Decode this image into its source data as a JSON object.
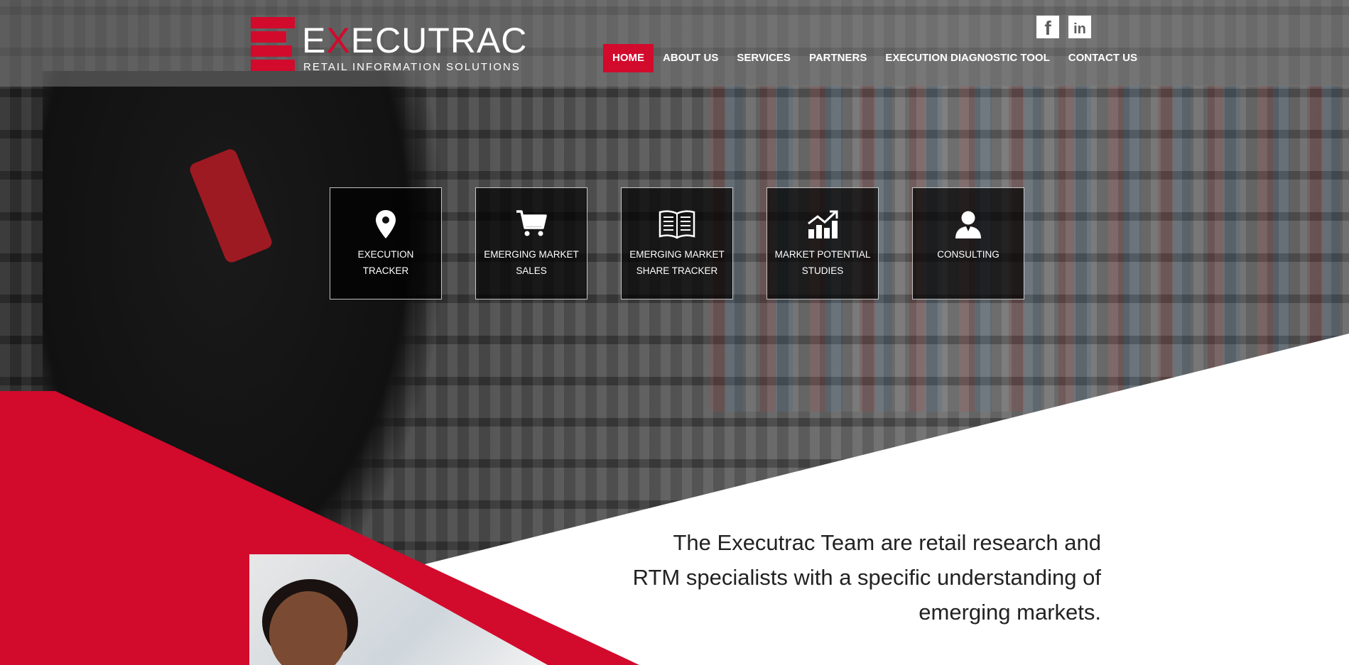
{
  "brand": {
    "name_prefix": "E",
    "name_highlight": "X",
    "name_suffix": "ECUTRAC",
    "tagline": "RETAIL INFORMATION SOLUTIONS",
    "accent_color": "#d20a2c"
  },
  "social": {
    "facebook_glyph": "f",
    "linkedin_glyph": "in"
  },
  "nav": {
    "items": [
      {
        "label": "HOME",
        "active": true
      },
      {
        "label": "ABOUT US"
      },
      {
        "label": "SERVICES"
      },
      {
        "label": "PARTNERS"
      },
      {
        "label": "EXECUTION DIAGNOSTIC TOOL"
      },
      {
        "label": "CONTACT US"
      }
    ]
  },
  "services": [
    {
      "icon": "map-pin-icon",
      "label": "EXECUTION TRACKER"
    },
    {
      "icon": "shopping-cart-icon",
      "label": "EMERGING MARKET SALES"
    },
    {
      "icon": "open-book-icon",
      "label": "EMERGING MARKET SHARE TRACKER"
    },
    {
      "icon": "growth-chart-icon",
      "label": "MARKET POTENTIAL STUDIES"
    },
    {
      "icon": "consultant-icon",
      "label": "CONSULTING"
    }
  ],
  "about": {
    "text": "The Executrac Team are retail research and RTM specialists with a specific understanding of emerging markets."
  }
}
